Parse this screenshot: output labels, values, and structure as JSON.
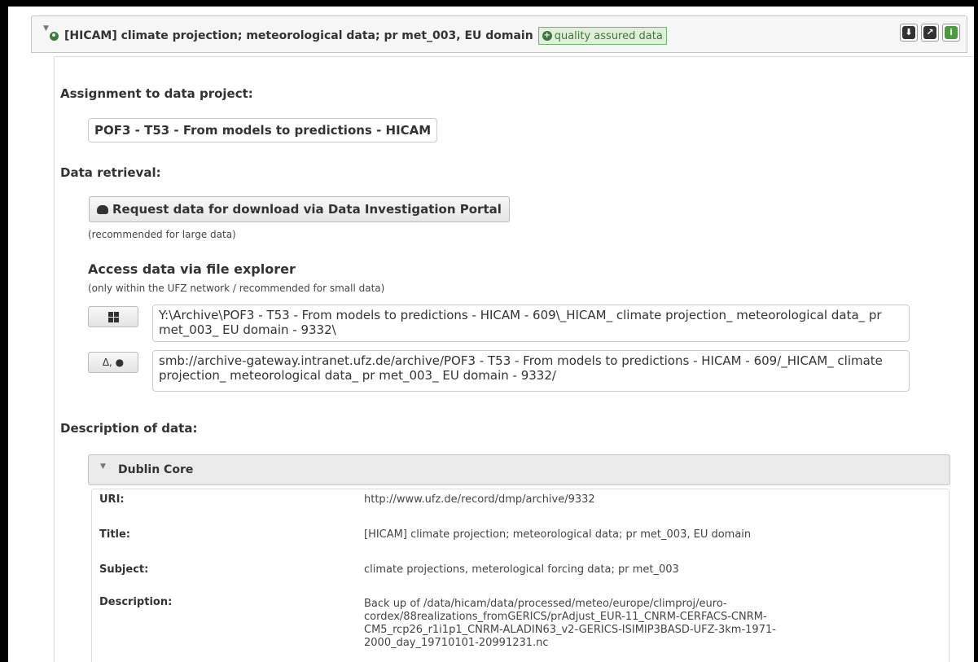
{
  "record": {
    "title": "[HICAM] climate projection; meteorological data; pr met_003, EU domain",
    "badge": "quality assured data",
    "header_icons": [
      "download-cloud-icon",
      "external-link-icon",
      "info-icon"
    ]
  },
  "project": {
    "heading": "Assignment to data project:",
    "name": "POF3 - T53 - From models to predictions - HICAM"
  },
  "retrieval": {
    "heading": "Data retrieval:",
    "download_button": "Request data for download via Data Investigation Portal",
    "download_note": "(recommended for large data)",
    "explorer_heading": "Access data via file explorer",
    "explorer_note": "(only within the UFZ network / recommended for small data)",
    "windows_path": "Y:\\Archive\\POF3 - T53 - From models to predictions - HICAM - 609\\_HICAM_ climate projection_ meteorological data_ pr met_003_ EU domain - 9332\\",
    "linux_mac_label": "Δ, ●",
    "smb_path": "smb://archive-gateway.intranet.ufz.de/archive/POF3 - T53 - From models to predictions - HICAM - 609/_HICAM_ climate projection_ meteorological data_ pr met_003_ EU domain - 9332/"
  },
  "description": {
    "heading": "Description of data:",
    "dublin_core_title": "Dublin Core",
    "rows": [
      {
        "key": "URI:",
        "value": "http://www.ufz.de/record/dmp/archive/9332"
      },
      {
        "key": "Title:",
        "value": "[HICAM] climate projection; meteorological data; pr met_003, EU domain"
      },
      {
        "key": "Subject:",
        "value": "climate projections, meterological forcing data; pr met_003"
      },
      {
        "key": "Description:",
        "value": "Back up of /data/hicam/data/processed/meteo/europe/climproj/euro-cordex/88realizations_fromGERICS/prAdjust_EUR-11_CNRM-CERFACS-CNRM-CM5_rcp26_r1i1p1_CNRM-ALADIN63_v2-GERICS-ISIMIP3BASD-UFZ-3km-1971-2000_day_19710101-20991231.nc"
      }
    ]
  },
  "colors": {
    "badge_bg": "#dff0d8",
    "badge_border": "#6fb36f",
    "info_green": "#4a9b3c",
    "header_bg": "#f6f6f6"
  }
}
